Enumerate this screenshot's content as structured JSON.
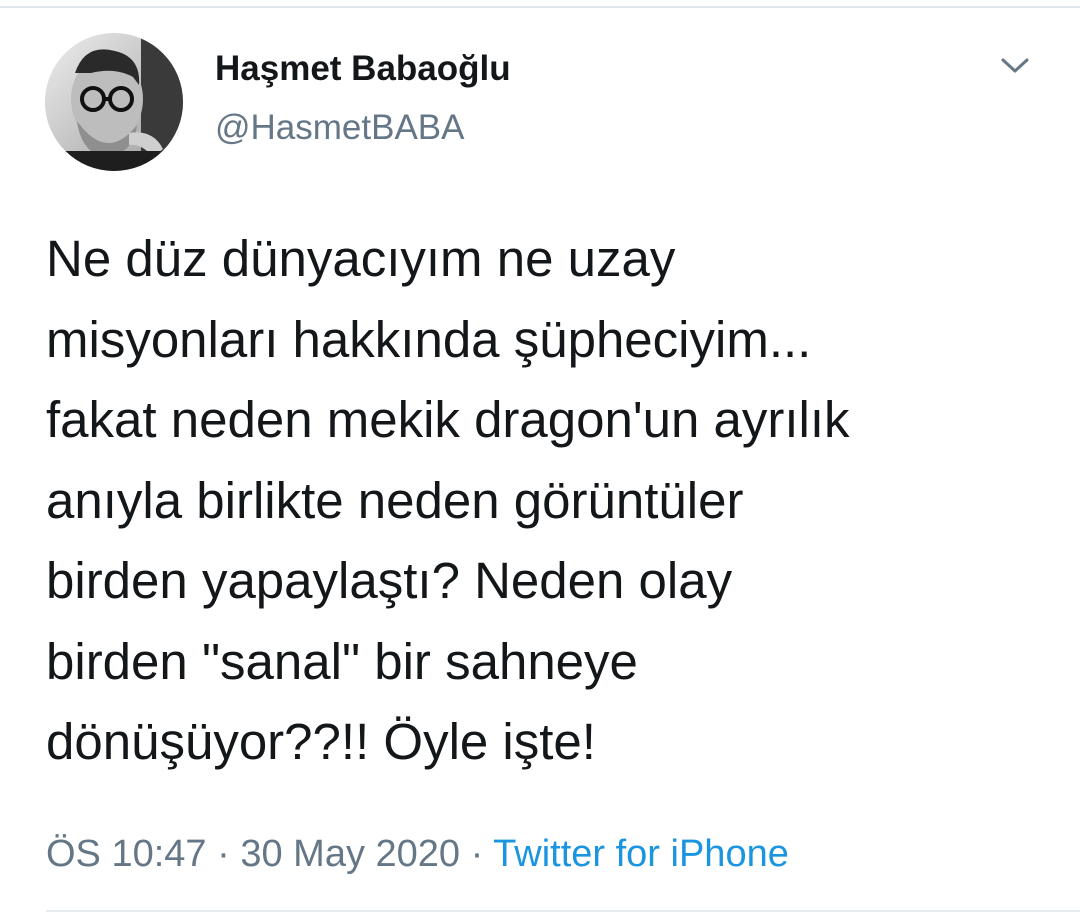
{
  "author": {
    "display_name": "Haşmet Babaoğlu",
    "handle": "@HasmetBABA"
  },
  "menu": {
    "icon": "chevron-down-icon"
  },
  "tweet": {
    "lines": [
      "Ne düz dünyacıyım ne uzay",
      "misyonları hakkında şüpheciyim...",
      "fakat neden mekik dragon'un ayrılık",
      "anıyla birlikte neden görüntüler",
      "birden yapaylaştı? Neden olay",
      "birden \"sanal\" bir sahneye",
      "dönüşüyor??!! Öyle işte!"
    ]
  },
  "meta": {
    "time": "ÖS 10:47",
    "separator": "·",
    "date": "30 May 2020",
    "source": "Twitter for iPhone"
  },
  "colors": {
    "text": "#14171a",
    "secondary": "#657786",
    "link": "#1b95e0",
    "divider": "#e1e8ed"
  }
}
